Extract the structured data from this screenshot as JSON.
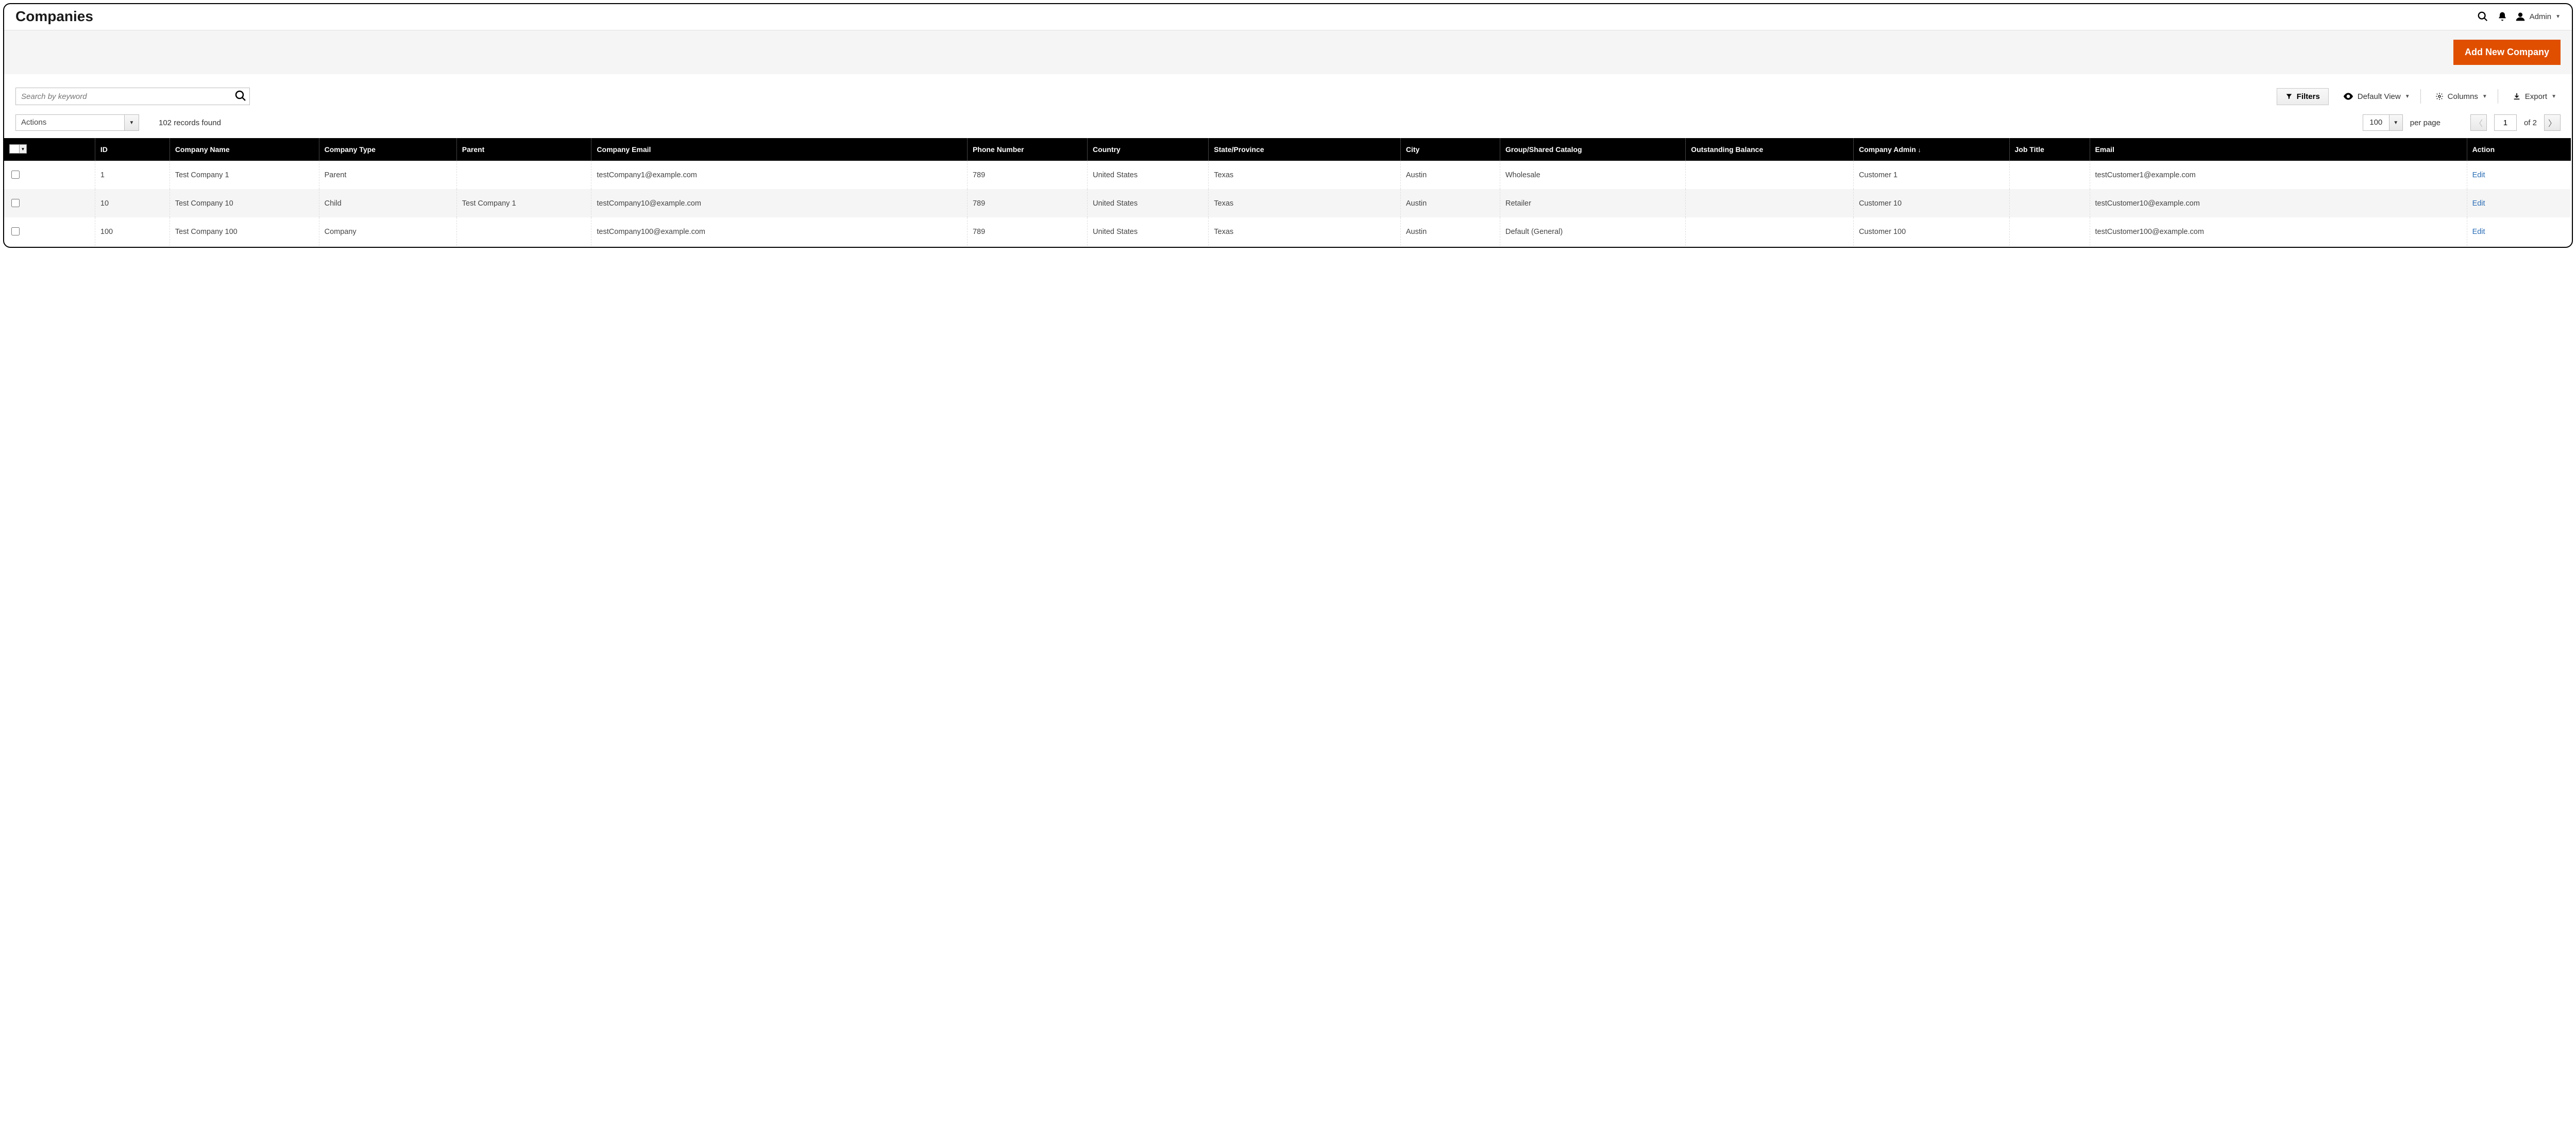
{
  "header": {
    "title": "Companies",
    "user_name": "Admin"
  },
  "banner": {
    "add_button": "Add New Company"
  },
  "toolbar": {
    "search_placeholder": "Search by keyword",
    "filters_label": "Filters",
    "default_view_label": "Default View",
    "columns_label": "Columns",
    "export_label": "Export"
  },
  "pager": {
    "actions_label": "Actions",
    "records_found": "102 records found",
    "per_page_value": "100",
    "per_page_label": "per page",
    "page_value": "1",
    "of_label": "of 2"
  },
  "columns": {
    "id": "ID",
    "company_name": "Company Name",
    "company_type": "Company Type",
    "parent": "Parent",
    "company_email": "Company Email",
    "phone": "Phone Number",
    "country": "Country",
    "state": "State/Province",
    "city": "City",
    "group": "Group/Shared Catalog",
    "balance": "Outstanding Balance",
    "admin": "Company Admin",
    "job": "Job Title",
    "email": "Email",
    "action": "Action"
  },
  "rows": [
    {
      "id": "1",
      "company_name": "Test Company 1",
      "company_type": "Parent",
      "parent": "",
      "company_email": "testCompany1@example.com",
      "phone": "789",
      "country": "United States",
      "state": "Texas",
      "city": "Austin",
      "group": "Wholesale",
      "balance": "",
      "admin": "Customer 1",
      "job": "",
      "email": "testCustomer1@example.com",
      "action": "Edit"
    },
    {
      "id": "10",
      "company_name": "Test Company 10",
      "company_type": "Child",
      "parent": "Test Company 1",
      "company_email": "testCompany10@example.com",
      "phone": "789",
      "country": "United States",
      "state": "Texas",
      "city": "Austin",
      "group": "Retailer",
      "balance": "",
      "admin": "Customer 10",
      "job": "",
      "email": "testCustomer10@example.com",
      "action": "Edit"
    },
    {
      "id": "100",
      "company_name": "Test Company 100",
      "company_type": "Company",
      "parent": "",
      "company_email": "testCompany100@example.com",
      "phone": "789",
      "country": "United States",
      "state": "Texas",
      "city": "Austin",
      "group": "Default (General)",
      "balance": "",
      "admin": "Customer 100",
      "job": "",
      "email": "testCustomer100@example.com",
      "action": "Edit"
    }
  ]
}
